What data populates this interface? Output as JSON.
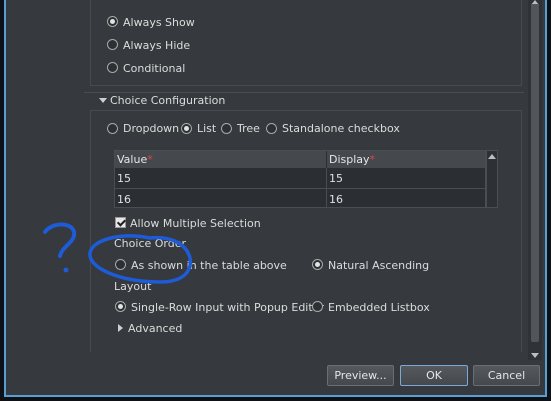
{
  "visibility": {
    "options": [
      {
        "label": "Always Show",
        "selected": true
      },
      {
        "label": "Always Hide",
        "selected": false
      },
      {
        "label": "Conditional",
        "selected": false
      }
    ]
  },
  "choice_config": {
    "title": "Choice Configuration",
    "types": [
      {
        "label": "Dropdown",
        "selected": false
      },
      {
        "label": "List",
        "selected": true
      },
      {
        "label": "Tree",
        "selected": false
      },
      {
        "label": "Standalone checkbox",
        "selected": false
      }
    ],
    "table": {
      "headers": [
        "Value",
        "Display"
      ],
      "required_mark": "*",
      "rows": [
        [
          "15",
          "15"
        ],
        [
          "16",
          "16"
        ]
      ]
    },
    "allow_multiple": {
      "label": "Allow Multiple Selection",
      "checked": true
    },
    "choice_order": {
      "title": "Choice Order",
      "options": [
        {
          "label": "As shown in the table above",
          "selected": false
        },
        {
          "label": "Natural Ascending",
          "selected": true
        }
      ]
    },
    "layout": {
      "title": "Layout",
      "options": [
        {
          "label": "Single-Row Input with Popup Editor",
          "selected": true
        },
        {
          "label": "Embedded Listbox",
          "selected": false
        }
      ]
    },
    "advanced": {
      "label": "Advanced"
    }
  },
  "buttons": {
    "preview": "Preview...",
    "ok": "OK",
    "cancel": "Cancel"
  },
  "annotation": {
    "mark": "?",
    "color": "#1e5bd6"
  }
}
